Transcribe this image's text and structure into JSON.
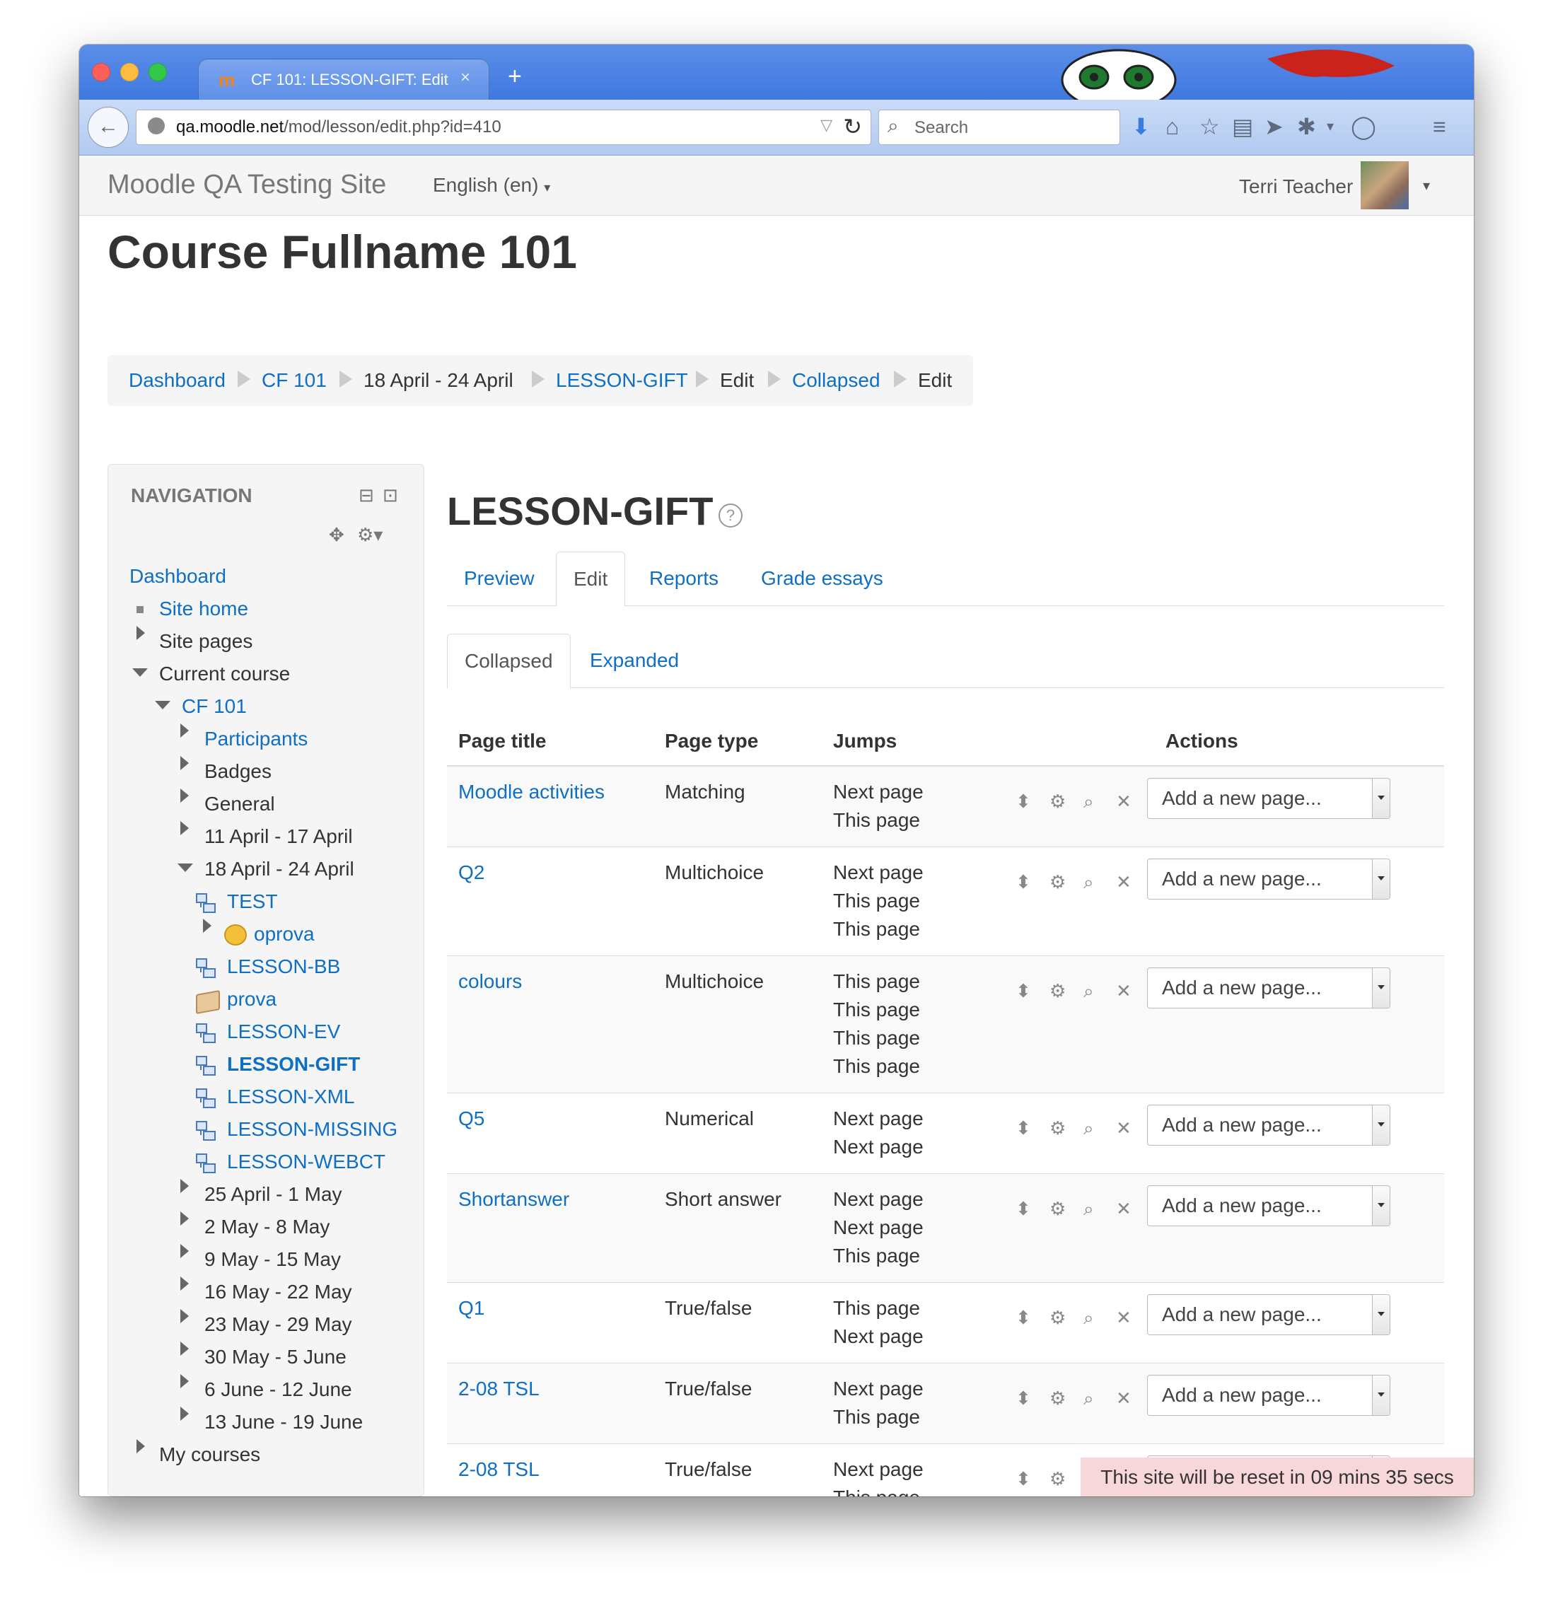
{
  "browser": {
    "tab_title": "CF 101: LESSON-GIFT: Edit",
    "url_domain": "qa.moodle.net",
    "url_path": "/mod/lesson/edit.php?id=410",
    "search_placeholder": "Search"
  },
  "navbar": {
    "brand": "Moodle QA Testing Site",
    "language": "English (en)",
    "user_name": "Terri Teacher"
  },
  "course_title": "Course Fullname 101",
  "breadcrumb": [
    "Dashboard",
    "CF 101",
    "18 April - 24 April",
    "LESSON-GIFT",
    "Edit",
    "Collapsed",
    "Edit"
  ],
  "navigation": {
    "title": "NAVIGATION",
    "items": [
      "Dashboard",
      "Site home",
      "Site pages",
      "Current course",
      "CF 101",
      "Participants",
      "Badges",
      "General",
      "11 April - 17 April",
      "18 April - 24 April",
      "TEST",
      "oprova",
      "LESSON-BB",
      "prova",
      "LESSON-EV",
      "LESSON-GIFT",
      "LESSON-XML",
      "LESSON-MISSING",
      "LESSON-WEBCT",
      "25 April - 1 May",
      "2 May - 8 May",
      "9 May - 15 May",
      "16 May - 22 May",
      "23 May - 29 May",
      "30 May - 5 June",
      "6 June - 12 June",
      "13 June - 19 June",
      "My courses"
    ]
  },
  "lesson": {
    "title": "LESSON-GIFT",
    "tabs": [
      "Preview",
      "Edit",
      "Reports",
      "Grade essays"
    ],
    "subtabs": [
      "Collapsed",
      "Expanded"
    ]
  },
  "table": {
    "headers": [
      "Page title",
      "Page type",
      "Jumps",
      "Actions"
    ],
    "add_page_label": "Add a new page...",
    "rows": [
      {
        "title": "Moodle activities",
        "type": "Matching",
        "jumps": [
          "Next page",
          "This page"
        ]
      },
      {
        "title": "Q2",
        "type": "Multichoice",
        "jumps": [
          "Next page",
          "This page",
          "This page"
        ]
      },
      {
        "title": "colours",
        "type": "Multichoice",
        "jumps": [
          "This page",
          "This page",
          "This page",
          "This page"
        ]
      },
      {
        "title": "Q5",
        "type": "Numerical",
        "jumps": [
          "Next page",
          "Next page"
        ]
      },
      {
        "title": "Shortanswer",
        "type": "Short answer",
        "jumps": [
          "Next page",
          "Next page",
          "This page"
        ]
      },
      {
        "title": "Q1",
        "type": "True/false",
        "jumps": [
          "This page",
          "Next page"
        ]
      },
      {
        "title": "2-08 TSL",
        "type": "True/false",
        "jumps": [
          "Next page",
          "This page"
        ]
      },
      {
        "title": "2-08 TSL",
        "type": "True/false",
        "jumps": [
          "Next page",
          "This page"
        ]
      }
    ]
  },
  "reset_notice": "This site will be reset in 09 mins 35 secs",
  "colors": {
    "link": "#0f6fc5",
    "titlebar": "#3f78e0",
    "notice_bg": "#f8d7da"
  }
}
